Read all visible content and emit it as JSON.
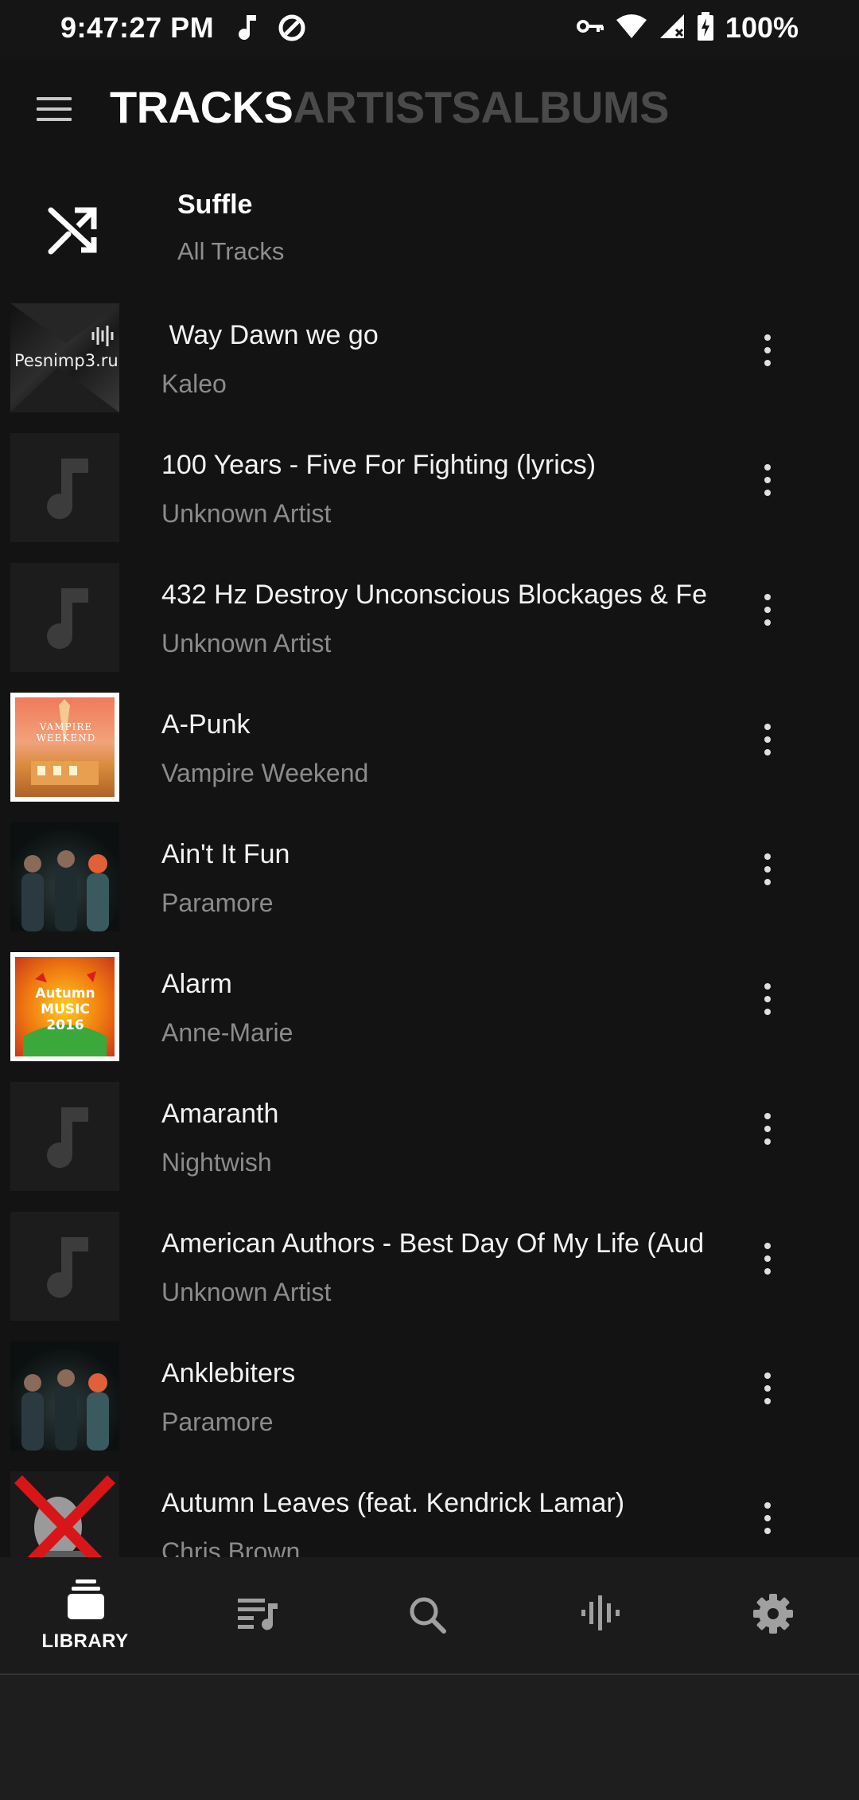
{
  "status_bar": {
    "time": "9:47:27 PM",
    "battery": "100%",
    "icons": [
      "music-note-icon",
      "data-saver-icon",
      "vpn-key-icon",
      "wifi-icon",
      "signal-icon",
      "battery-charging-icon"
    ]
  },
  "header": {
    "menu_icon": "hamburger-menu-icon",
    "tabs": [
      {
        "label": "TRACKS",
        "active": true
      },
      {
        "label": "ARTISTS",
        "active": false
      },
      {
        "label": "ALBUMS",
        "active": false
      }
    ]
  },
  "shuffle": {
    "title": "Suffle",
    "subtitle": "All Tracks",
    "icon": "shuffle-icon"
  },
  "tracks": [
    {
      "title": " Way Dawn we go",
      "artist": "Kaleo",
      "art": "pesnimp3-art",
      "art_text": "Pesnimp3.ru"
    },
    {
      "title": "100 Years - Five For Fighting (lyrics)",
      "artist": "Unknown Artist",
      "art": "placeholder"
    },
    {
      "title": "432 Hz Destroy Unconscious Blockages & Fe",
      "artist": "Unknown Artist",
      "art": "placeholder"
    },
    {
      "title": "A-Punk",
      "artist": "Vampire Weekend",
      "art": "vampire-weekend-art",
      "art_text": "VAMPIRE WEEKEND"
    },
    {
      "title": "Ain't It Fun",
      "artist": "Paramore",
      "art": "paramore-art"
    },
    {
      "title": "Alarm",
      "artist": "Anne-Marie",
      "art": "autumn-music-art",
      "art_text": "Autumn MUSIC 2016"
    },
    {
      "title": "Amaranth",
      "artist": "Nightwish",
      "art": "placeholder"
    },
    {
      "title": "American Authors - Best Day Of My Life (Aud",
      "artist": "Unknown Artist",
      "art": "placeholder"
    },
    {
      "title": "Anklebiters",
      "artist": "Paramore",
      "art": "paramore-art"
    },
    {
      "title": "Autumn Leaves (feat. Kendrick Lamar)",
      "artist": "Chris Brown",
      "art": "chris-brown-art"
    }
  ],
  "bottom_nav": {
    "items": [
      {
        "label": "LIBRARY",
        "icon": "library-icon",
        "active": true
      },
      {
        "label": "",
        "icon": "playlist-icon",
        "active": false
      },
      {
        "label": "",
        "icon": "search-icon",
        "active": false
      },
      {
        "label": "",
        "icon": "equalizer-icon",
        "active": false
      },
      {
        "label": "",
        "icon": "settings-icon",
        "active": false
      }
    ]
  },
  "colors": {
    "background": "#131313",
    "text_primary": "#f2f2f2",
    "text_secondary": "#8b8b8b",
    "tab_inactive": "#4a4a4a",
    "nav_background": "#1b1b1b"
  }
}
